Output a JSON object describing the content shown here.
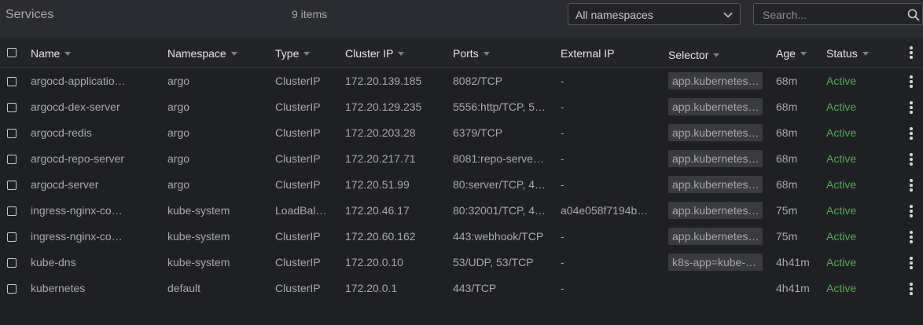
{
  "header": {
    "title": "Services",
    "item_count": "9 items",
    "namespace_select": "All namespaces",
    "search_placeholder": "Search..."
  },
  "columns": {
    "name": "Name",
    "namespace": "Namespace",
    "type": "Type",
    "cluster_ip": "Cluster IP",
    "ports": "Ports",
    "external_ip": "External IP",
    "selector": "Selector",
    "age": "Age",
    "status": "Status"
  },
  "status_color": "#4caf50",
  "rows": [
    {
      "name": "argocd-applicatio…",
      "namespace": "argo",
      "type": "ClusterIP",
      "cluster_ip": "172.20.139.185",
      "ports": "8082/TCP",
      "external_ip": "-",
      "selector": "app.kubernetes.…",
      "age": "68m",
      "status": "Active"
    },
    {
      "name": "argocd-dex-server",
      "namespace": "argo",
      "type": "ClusterIP",
      "cluster_ip": "172.20.129.235",
      "ports": "5556:http/TCP, 55…",
      "external_ip": "-",
      "selector": "app.kubernetes.…",
      "age": "68m",
      "status": "Active"
    },
    {
      "name": "argocd-redis",
      "namespace": "argo",
      "type": "ClusterIP",
      "cluster_ip": "172.20.203.28",
      "ports": "6379/TCP",
      "external_ip": "-",
      "selector": "app.kubernetes.…",
      "age": "68m",
      "status": "Active"
    },
    {
      "name": "argocd-repo-server",
      "namespace": "argo",
      "type": "ClusterIP",
      "cluster_ip": "172.20.217.71",
      "ports": "8081:repo-server/…",
      "external_ip": "-",
      "selector": "app.kubernetes.…",
      "age": "68m",
      "status": "Active"
    },
    {
      "name": "argocd-server",
      "namespace": "argo",
      "type": "ClusterIP",
      "cluster_ip": "172.20.51.99",
      "ports": "80:server/TCP, 44…",
      "external_ip": "-",
      "selector": "app.kubernetes.…",
      "age": "68m",
      "status": "Active"
    },
    {
      "name": "ingress-nginx-con…",
      "namespace": "kube-system",
      "type": "LoadBala…",
      "cluster_ip": "172.20.46.17",
      "ports": "80:32001/TCP, 44…",
      "external_ip": "a04e058f7194b4…",
      "selector": "app.kubernetes.…",
      "age": "75m",
      "status": "Active"
    },
    {
      "name": "ingress-nginx-con…",
      "namespace": "kube-system",
      "type": "ClusterIP",
      "cluster_ip": "172.20.60.162",
      "ports": "443:webhook/TCP",
      "external_ip": "-",
      "selector": "app.kubernetes.…",
      "age": "75m",
      "status": "Active"
    },
    {
      "name": "kube-dns",
      "namespace": "kube-system",
      "type": "ClusterIP",
      "cluster_ip": "172.20.0.10",
      "ports": "53/UDP, 53/TCP",
      "external_ip": "-",
      "selector": "k8s-app=kube-d…",
      "age": "4h41m",
      "status": "Active"
    },
    {
      "name": "kubernetes",
      "namespace": "default",
      "type": "ClusterIP",
      "cluster_ip": "172.20.0.1",
      "ports": "443/TCP",
      "external_ip": "-",
      "selector": "",
      "age": "4h41m",
      "status": "Active"
    }
  ]
}
